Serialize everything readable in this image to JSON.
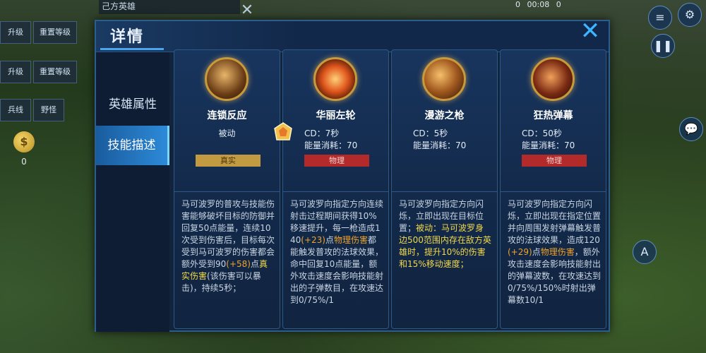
{
  "background_hud": {
    "left_top_title": "己方英雄",
    "upgrade_label": "升级",
    "reset_level_label": "重置等级",
    "upgrade_label_2": "升级",
    "reset_level_label_2": "重置等级",
    "minion_label": "兵线",
    "jungle_label": "野怪",
    "gold_count": "0",
    "time": "00:08",
    "kills": "0",
    "deaths": "0"
  },
  "panel": {
    "title": "详情",
    "tabs": [
      {
        "label": "英雄属性",
        "active": false
      },
      {
        "label": "技能描述",
        "active": true
      }
    ]
  },
  "skills": [
    {
      "name": "连锁反应",
      "type": "被动",
      "cd": "",
      "energy": "",
      "damage_tag": "真实",
      "damage_color": "#c29a42",
      "desc_parts": [
        {
          "t": "马可波罗的普攻与技能伤害能够破坏目标的防御并回复50点能量，连续10次受到伤害后，目标每次受到马可波罗的伤害都会额外受到90",
          "c": ""
        },
        {
          "t": "(+58)",
          "c": "orange"
        },
        {
          "t": "点",
          "c": ""
        },
        {
          "t": "真实伤害",
          "c": "yellow"
        },
        {
          "t": "(该伤害可以暴击)，持续5秒；",
          "c": ""
        }
      ]
    },
    {
      "name": "华丽左轮",
      "type": "",
      "cd": "CD：7秒",
      "energy": "能量消耗：70",
      "damage_tag": "物理",
      "damage_color": "#b22a2a",
      "desc_parts": [
        {
          "t": "马可波罗向指定方向连续射击过程期间获得10%移速提升，每一枪造成140",
          "c": ""
        },
        {
          "t": "(+23)",
          "c": "orange"
        },
        {
          "t": "点",
          "c": ""
        },
        {
          "t": "物理伤害",
          "c": "orange"
        },
        {
          "t": "都能触发普攻的法球效果，命中回复10点能量，额外攻击速度会影响技能射出的子弹数目，在攻速达到0/75%/1",
          "c": ""
        }
      ]
    },
    {
      "name": "漫游之枪",
      "type": "",
      "cd": "CD：5秒",
      "energy": "能量消耗：70",
      "damage_tag": "",
      "damage_color": "",
      "desc_parts": [
        {
          "t": "马可波罗向指定方向闪烁，立即出现在目标位置；",
          "c": ""
        },
        {
          "t": "被动：马可波罗身边500范围内存在敌方英雄时，提升10%的伤害和15%移动速度；",
          "c": "yellow"
        }
      ]
    },
    {
      "name": "狂热弹幕",
      "type": "",
      "cd": "CD：50秒",
      "energy": "能量消耗：70",
      "damage_tag": "物理",
      "damage_color": "#b22a2a",
      "desc_parts": [
        {
          "t": "马可波罗向指定方向闪烁，立即出现在指定位置并向周围发射弹幕触发普攻的法球效果，造成120",
          "c": ""
        },
        {
          "t": "(+29)",
          "c": "orange"
        },
        {
          "t": "点",
          "c": ""
        },
        {
          "t": "物理伤害",
          "c": "orange"
        },
        {
          "t": "，额外攻击速度会影响技能射出的弹幕波数，在攻速达到0/75%/150%时射出弹幕数10/1",
          "c": ""
        }
      ]
    }
  ],
  "icons": {
    "skill_1": "chain-reaction-skill-icon",
    "skill_2": "gorgeous-revolver-skill-icon",
    "skill_3": "roaming-gun-skill-icon",
    "skill_4": "frenzy-barrage-skill-icon"
  }
}
